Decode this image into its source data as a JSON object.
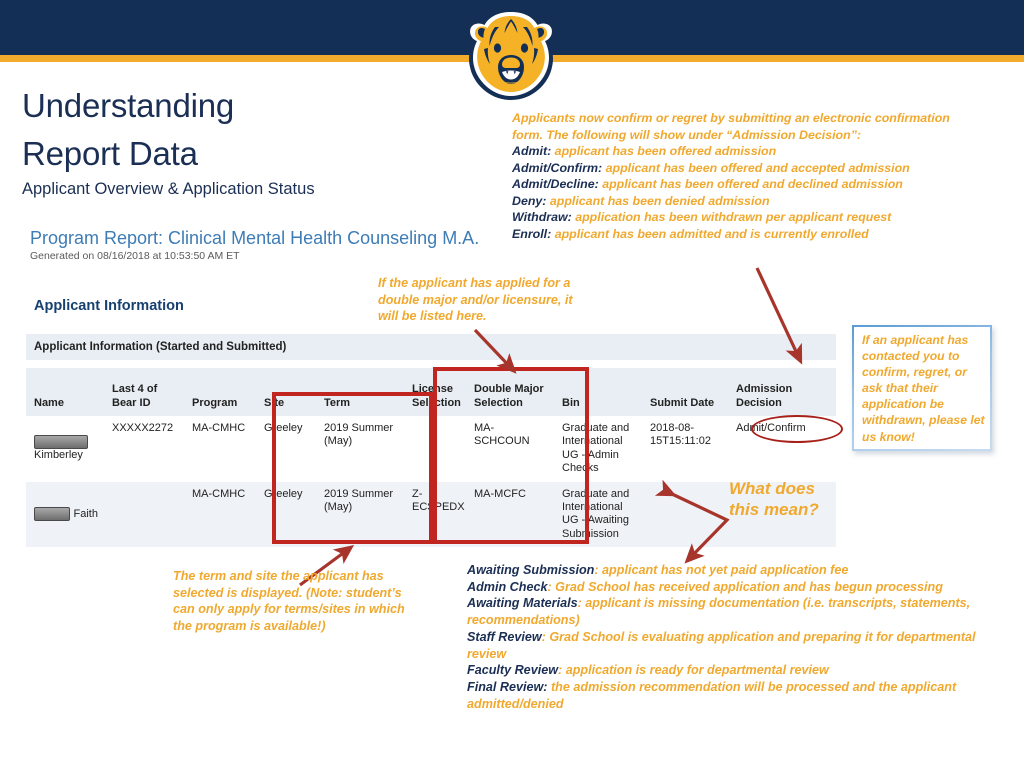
{
  "brand": {
    "navy": "#142f55",
    "gold": "#f3ab2c",
    "annotation_gold": "#f0a92e",
    "red": "#c0261f",
    "link_blue": "#3d7cb5"
  },
  "header": {
    "logo_name": "unc-bear-logo",
    "title_line1": "Understanding",
    "title_line2": "Report Data",
    "subtitle": "Applicant Overview & Application Status"
  },
  "report": {
    "program_report": "Program Report: Clinical Mental Health Counseling M.A.",
    "generated": "Generated on 08/16/2018 at 10:53:50 AM ET",
    "section_heading": "Applicant Information",
    "table_title": "Applicant Information (Started and Submitted)",
    "columns": [
      "Name",
      "Last 4 of Bear ID",
      "Program",
      "Site",
      "Term",
      "License Selection",
      "Double Major Selection",
      "Bin",
      "Submit Date",
      "Admission Decision"
    ],
    "rows": [
      {
        "name": "Kimberley",
        "name_redacted": true,
        "bear_id": "XXXXX2272",
        "program": "MA-CMHC",
        "site": "Greeley",
        "term": "2019 Summer (May)",
        "license": "",
        "double_major": "MA-SCHCOUN",
        "bin": "Graduate and International UG - Admin Checks",
        "submit_date": "2018-08-15T15:11:02",
        "decision": "Admit/Confirm"
      },
      {
        "name": "Faith",
        "name_redacted": true,
        "bear_id": "",
        "program": "MA-CMHC",
        "site": "Greeley",
        "term": "2019 Summer (May)",
        "license": "Z-ECSPEDX",
        "double_major": "MA-MCFC",
        "bin": "Graduate and International UG - Awaiting Submission",
        "submit_date": "",
        "decision": ""
      }
    ]
  },
  "annotations": {
    "decisions": {
      "intro": "Applicants now confirm or regret by submitting an electronic confirmation form. The following will show under “Admission Decision”:",
      "items": [
        {
          "label": "Admit:",
          "text": " applicant has been offered admission"
        },
        {
          "label": "Admit/Confirm:",
          "text": " applicant has been offered and accepted admission"
        },
        {
          "label": "Admit/Decline:",
          "text": " applicant has been offered and declined admission"
        },
        {
          "label": "Deny:",
          "text": " applicant has been denied admission"
        },
        {
          "label": "Withdraw:",
          "text": " application has been withdrawn per applicant request"
        },
        {
          "label": "Enroll:",
          "text": " applicant has been admitted and is currently enrolled"
        }
      ]
    },
    "double_major": "If the applicant has applied for a double major and/or licensure, it will be listed here.",
    "term_site": "The term and site the applicant has selected is displayed. (Note: student’s can only apply for terms/sites in which the program is available!)",
    "what_does_this_mean": "What does this mean?",
    "callout": "If an applicant has contacted you to confirm, regret, or ask that their application be withdrawn, please let us know!",
    "bins": {
      "items": [
        {
          "label": "Awaiting Submission",
          "text": ": applicant has not yet paid application fee"
        },
        {
          "label": "Admin Check",
          "text": ": Grad School has received application and has begun processing"
        },
        {
          "label": "Awaiting Materials",
          "text": ": applicant is missing documentation (i.e. transcripts, statements, recommendations)"
        },
        {
          "label": "Staff Review",
          "text": ": Grad School is evaluating application and preparing it for departmental review"
        },
        {
          "label": "Faculty Review",
          "text": ": application is ready for departmental review"
        },
        {
          "label": "Final Review:",
          "text": " the admission recommendation will be processed and the applicant admitted/denied"
        }
      ]
    }
  }
}
